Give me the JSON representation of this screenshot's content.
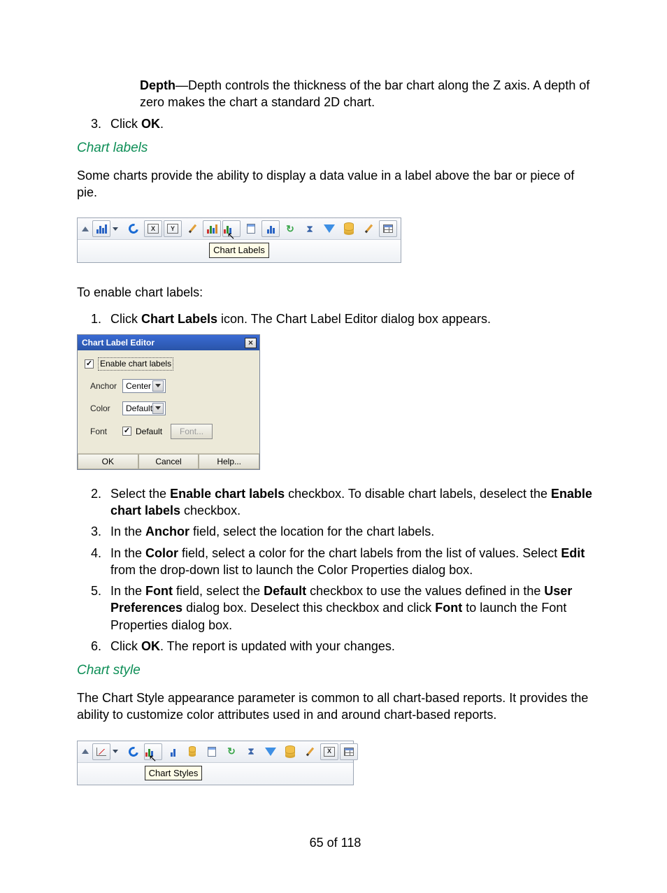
{
  "depth_block": {
    "prefix_bold": "Depth",
    "dash": "—",
    "text": "Depth controls the thickness of the bar chart along the Z axis. A depth of zero makes the chart a standard 2D chart."
  },
  "step_click_ok": {
    "num": "3.",
    "prefix": "Click ",
    "bold": "OK",
    "suffix": "."
  },
  "heading_labels": "Chart labels",
  "para_labels_intro": "Some charts provide the ability to display a data value in a label above the bar or piece of pie.",
  "toolbar1": {
    "tooltip": "Chart Labels",
    "icons": [
      "bar-chart",
      "dropdown",
      "undo",
      "x-axis",
      "y-axis",
      "edit",
      "bars-color",
      "chart-labels",
      "doc",
      "bars-plain",
      "refresh",
      "hourglass",
      "funnel",
      "database",
      "edit2",
      "table"
    ]
  },
  "para_enable": "To enable chart labels:",
  "steps_labels": {
    "s1": {
      "num": "1.",
      "pre": "Click ",
      "b1": "Chart Labels",
      "post": " icon. The Chart Label Editor dialog box appears."
    },
    "s2": {
      "num": "2.",
      "pre": "Select the ",
      "b1": "Enable chart labels",
      "mid": " checkbox. To disable chart labels, deselect the ",
      "b2": "Enable chart labels",
      "post": " checkbox."
    },
    "s3": {
      "num": "3.",
      "pre": "In the ",
      "b1": "Anchor",
      "post": " field, select the location for the chart labels."
    },
    "s4": {
      "num": "4.",
      "pre": "In the ",
      "b1": "Color",
      "mid": " field, select a color for the chart labels from the list of values. Select ",
      "b2": "Edit",
      "post": " from the drop-down list to launch the Color Properties dialog box."
    },
    "s5": {
      "num": "5.",
      "pre": "In the ",
      "b1": "Font",
      "mid1": " field, select the ",
      "b2": "Default",
      "mid2": " checkbox to use the values defined in the ",
      "b3": "User Preferences",
      "mid3": " dialog box. Deselect this checkbox and click ",
      "b4": "Font",
      "post": " to launch the Font Properties dialog box."
    },
    "s6": {
      "num": "6.",
      "pre": "Click ",
      "b1": "OK",
      "post": ". The report is updated with your changes."
    }
  },
  "dialog": {
    "title": "Chart Label Editor",
    "enable_label": "Enable chart labels",
    "anchor_label": "Anchor",
    "anchor_value": "Center",
    "color_label": "Color",
    "color_value": "Default",
    "font_label": "Font",
    "font_default": "Default",
    "font_button": "Font...",
    "ok": "OK",
    "cancel": "Cancel",
    "help": "Help..."
  },
  "heading_style": "Chart style",
  "para_style_intro": "The Chart Style appearance parameter is common to all chart-based reports. It provides the ability to customize color attributes used in and around chart-based reports.",
  "toolbar2": {
    "tooltip": "Chart Styles",
    "icons": [
      "line-chart",
      "dropdown",
      "undo",
      "chart-styles",
      "bars-small",
      "database-small",
      "doc",
      "refresh",
      "hourglass",
      "funnel",
      "database",
      "edit",
      "x-axis",
      "table"
    ]
  },
  "footer": "65 of 118"
}
